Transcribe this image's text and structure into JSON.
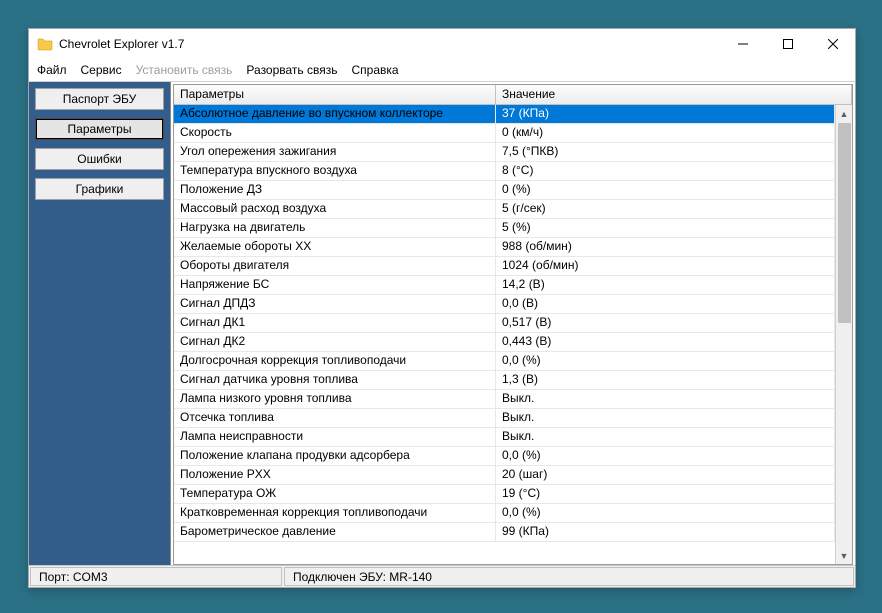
{
  "app": {
    "title": "Chevrolet Explorer v1.7",
    "icon_name": "folder-icon"
  },
  "menu": {
    "file": "Файл",
    "service": "Сервис",
    "connect": "Установить связь",
    "disconnect": "Разорвать связь",
    "help": "Справка"
  },
  "sidebar": {
    "passport": "Паспорт ЭБУ",
    "parameters": "Параметры",
    "errors": "Ошибки",
    "charts": "Графики"
  },
  "grid": {
    "header": {
      "param": "Параметры",
      "value": "Значение"
    },
    "rows": [
      {
        "p": "Абсолютное давление во впускном коллекторе",
        "v": "37  (КПа)",
        "sel": true
      },
      {
        "p": "Скорость",
        "v": "0  (км/ч)"
      },
      {
        "p": "Угол опережения зажигания",
        "v": "7,5  (°ПКВ)"
      },
      {
        "p": "Температура впускного воздуха",
        "v": "8  (°C)"
      },
      {
        "p": "Положение ДЗ",
        "v": "0  (%)"
      },
      {
        "p": "Массовый расход воздуха",
        "v": "5  (г/сек)"
      },
      {
        "p": "Нагрузка на двигатель",
        "v": "5  (%)"
      },
      {
        "p": "Желаемые обороты XX",
        "v": "988  (об/мин)"
      },
      {
        "p": "Обороты двигателя",
        "v": "1024  (об/мин)"
      },
      {
        "p": "Напряжение БС",
        "v": "14,2  (В)"
      },
      {
        "p": "Сигнал ДПДЗ",
        "v": "0,0  (В)"
      },
      {
        "p": "Сигнал ДК1",
        "v": "0,517  (В)"
      },
      {
        "p": "Сигнал ДК2",
        "v": "0,443  (В)"
      },
      {
        "p": "Долгосрочная коррекция топливоподачи",
        "v": "0,0  (%)"
      },
      {
        "p": "Сигнал датчика уровня топлива",
        "v": "1,3  (В)"
      },
      {
        "p": "Лампа низкого уровня топлива",
        "v": "Выкл."
      },
      {
        "p": "Отсечка топлива",
        "v": "Выкл."
      },
      {
        "p": "Лампа неисправности",
        "v": "Выкл."
      },
      {
        "p": "Положение клапана продувки адсорбера",
        "v": "0,0  (%)"
      },
      {
        "p": "Положение РXX",
        "v": "20  (шаг)"
      },
      {
        "p": "Температура ОЖ",
        "v": "19  (°C)"
      },
      {
        "p": "Кратковременная коррекция топливоподачи",
        "v": "0,0  (%)"
      },
      {
        "p": "Барометрическое давление",
        "v": "99  (КПа)"
      }
    ]
  },
  "status": {
    "port": "Порт: COM3",
    "connection": "Подключен ЭБУ: MR-140"
  }
}
